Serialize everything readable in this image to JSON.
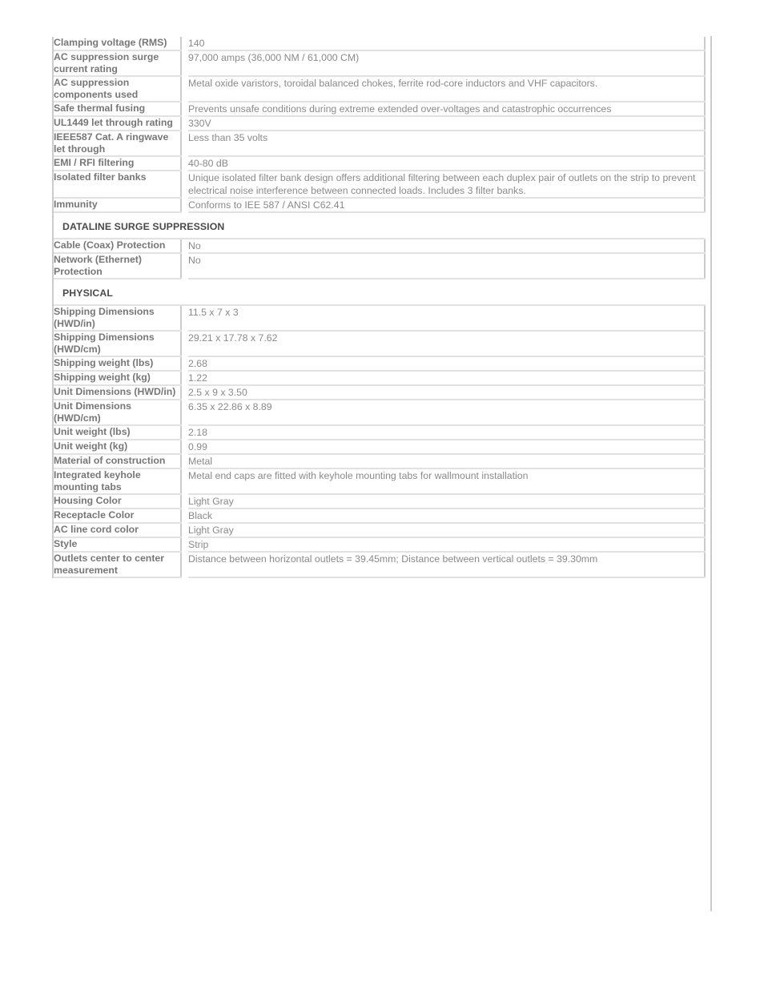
{
  "document": {
    "type": "product-specification-table",
    "colors": {
      "label_text": "#777777",
      "value_text": "#8a8a8a",
      "section_text": "#4a4a4a",
      "row_border": "#e2e2e2",
      "column_rule": "#cccccc",
      "background": "#ffffff"
    }
  },
  "spec_table": {
    "rows": [
      {
        "kind": "row",
        "label": "Clamping voltage (RMS)",
        "value": "140",
        "lines": 2
      },
      {
        "kind": "row",
        "label": "AC suppression surge current rating",
        "value": "97,000 amps (36,000 NM / 61,000 CM)",
        "lines": 2
      },
      {
        "kind": "row",
        "label": "AC suppression components used",
        "value": "Metal oxide varistors, toroidal balanced chokes, ferrite rod-core inductors and VHF capacitors.",
        "lines": 2
      },
      {
        "kind": "row",
        "label": "Safe thermal fusing",
        "value": "Prevents unsafe conditions during extreme extended over-voltages and catastrophic occurrences",
        "lines": 1
      },
      {
        "kind": "row",
        "label": "UL1449 let through rating",
        "value": "330V",
        "lines": 2
      },
      {
        "kind": "row",
        "label": "IEEE587 Cat. A ringwave let through",
        "value": "Less than 35 volts",
        "lines": 2
      },
      {
        "kind": "row",
        "label": "EMI / RFI filtering",
        "value": "40-80 dB",
        "lines": 1
      },
      {
        "kind": "row",
        "label": "Isolated filter banks",
        "value": "Unique isolated filter bank design offers additional filtering between each duplex pair of outlets on the strip to prevent electrical noise interference between connected loads. Includes 3 filter banks.",
        "lines": 2
      },
      {
        "kind": "row",
        "label": "Immunity",
        "value": "Conforms to IEE 587 / ANSI C62.41",
        "lines": 1
      },
      {
        "kind": "section",
        "label": "DATALINE SURGE SUPPRESSION"
      },
      {
        "kind": "row",
        "label": "Cable (Coax) Protection",
        "value": "No",
        "lines": 1
      },
      {
        "kind": "row",
        "label": "Network (Ethernet) Protection",
        "value": "No",
        "lines": 2
      },
      {
        "kind": "section",
        "label": "PHYSICAL"
      },
      {
        "kind": "row",
        "label": "Shipping Dimensions (HWD/in)",
        "value": "11.5 x 7 x 3",
        "lines": 2
      },
      {
        "kind": "row",
        "label": "Shipping Dimensions (HWD/cm)",
        "value": "29.21 x 17.78 x 7.62",
        "lines": 2
      },
      {
        "kind": "row",
        "label": "Shipping weight (lbs)",
        "value": "2.68",
        "lines": 1
      },
      {
        "kind": "row",
        "label": "Shipping weight (kg)",
        "value": "1.22",
        "lines": 1
      },
      {
        "kind": "row",
        "label": "Unit Dimensions (HWD/in)",
        "value": "2.5 x 9 x 3.50",
        "lines": 2
      },
      {
        "kind": "row",
        "label": "Unit Dimensions (HWD/cm)",
        "value": "6.35 x 22.86 x 8.89",
        "lines": 2
      },
      {
        "kind": "row",
        "label": "Unit weight (lbs)",
        "value": "2.18",
        "lines": 1
      },
      {
        "kind": "row",
        "label": "Unit weight (kg)",
        "value": "0.99",
        "lines": 1
      },
      {
        "kind": "row",
        "label": "Material of construction",
        "value": "Metal",
        "lines": 1
      },
      {
        "kind": "row",
        "label": "Integrated keyhole mounting tabs",
        "value": "Metal end caps are fitted with keyhole mounting tabs for wallmount installation",
        "lines": 2
      },
      {
        "kind": "row",
        "label": "Housing Color",
        "value": "Light Gray",
        "lines": 1
      },
      {
        "kind": "row",
        "label": "Receptacle Color",
        "value": "Black",
        "lines": 1
      },
      {
        "kind": "row",
        "label": "AC line cord color",
        "value": "Light Gray",
        "lines": 1
      },
      {
        "kind": "row",
        "label": "Style",
        "value": "Strip",
        "lines": 1
      },
      {
        "kind": "row",
        "label": "Outlets center to center measurement",
        "value": "Distance between horizontal outlets = 39.45mm; Distance between vertical outlets = 39.30mm",
        "lines": 2
      }
    ]
  }
}
